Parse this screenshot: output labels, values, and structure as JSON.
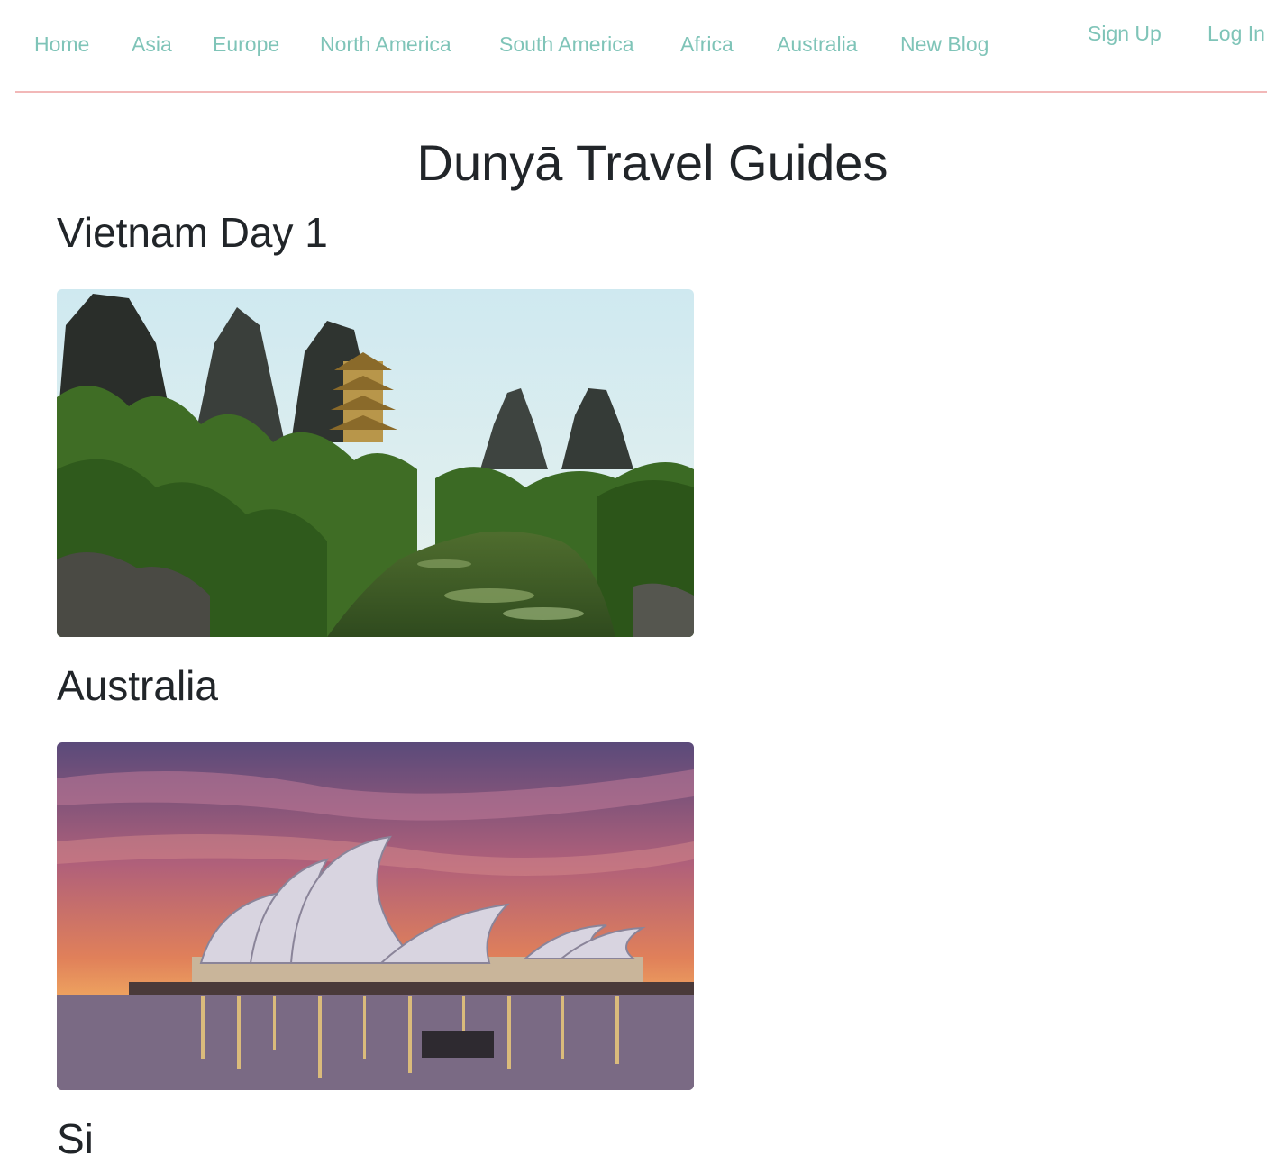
{
  "nav": {
    "links": [
      {
        "label": "Home"
      },
      {
        "label": "Asia"
      },
      {
        "label": "Europe"
      },
      {
        "label": "North America"
      },
      {
        "label": "South America"
      },
      {
        "label": "Africa"
      },
      {
        "label": "Australia"
      },
      {
        "label": "New Blog"
      }
    ],
    "auth": {
      "signup": "Sign Up",
      "login": "Log In"
    }
  },
  "site_title": "Dunyā Travel Guides",
  "posts": [
    {
      "title": "Vietnam Day 1",
      "image": "vietnam-karst-pagoda-river-photo"
    },
    {
      "title": "Australia",
      "image": "sydney-opera-house-sunset-photo"
    },
    {
      "title": "Si"
    }
  ],
  "colors": {
    "link": "#7fc4b8",
    "divider": "#f2b8b8",
    "text": "#212529"
  }
}
